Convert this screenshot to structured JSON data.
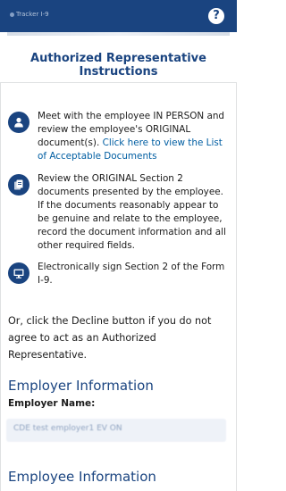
{
  "topbar": {
    "brand_label": "Tracker I-9",
    "help_icon": "question-circle-icon",
    "help_glyph": "?"
  },
  "header": {
    "title": "Authorized Representative Instructions"
  },
  "steps": [
    {
      "icon": "person-icon",
      "text": "Meet with the employee IN PERSON and review the employee's ORIGINAL document(s).",
      "link_text": "Click here to view the List of Acceptable Documents"
    },
    {
      "icon": "documents-icon",
      "text": "Review the ORIGINAL Section 2 documents presented by the employee. If the documents reasonably appear to be genuine and relate to the employee, record the document information and all other required fields."
    },
    {
      "icon": "monitor-icon",
      "text": "Electronically sign Section 2 of the Form I-9."
    }
  ],
  "decline_text": "Or, click the Decline button if you do not agree to act as an Authorized Representative.",
  "employer": {
    "heading": "Employer Information",
    "name_label": "Employer Name:",
    "name_value": "CDE test employer1 EV ON"
  },
  "employee": {
    "heading": "Employee Information"
  },
  "colors": {
    "primary": "#1a4480",
    "link": "#005ea2",
    "field_bg": "#eef2f8"
  }
}
